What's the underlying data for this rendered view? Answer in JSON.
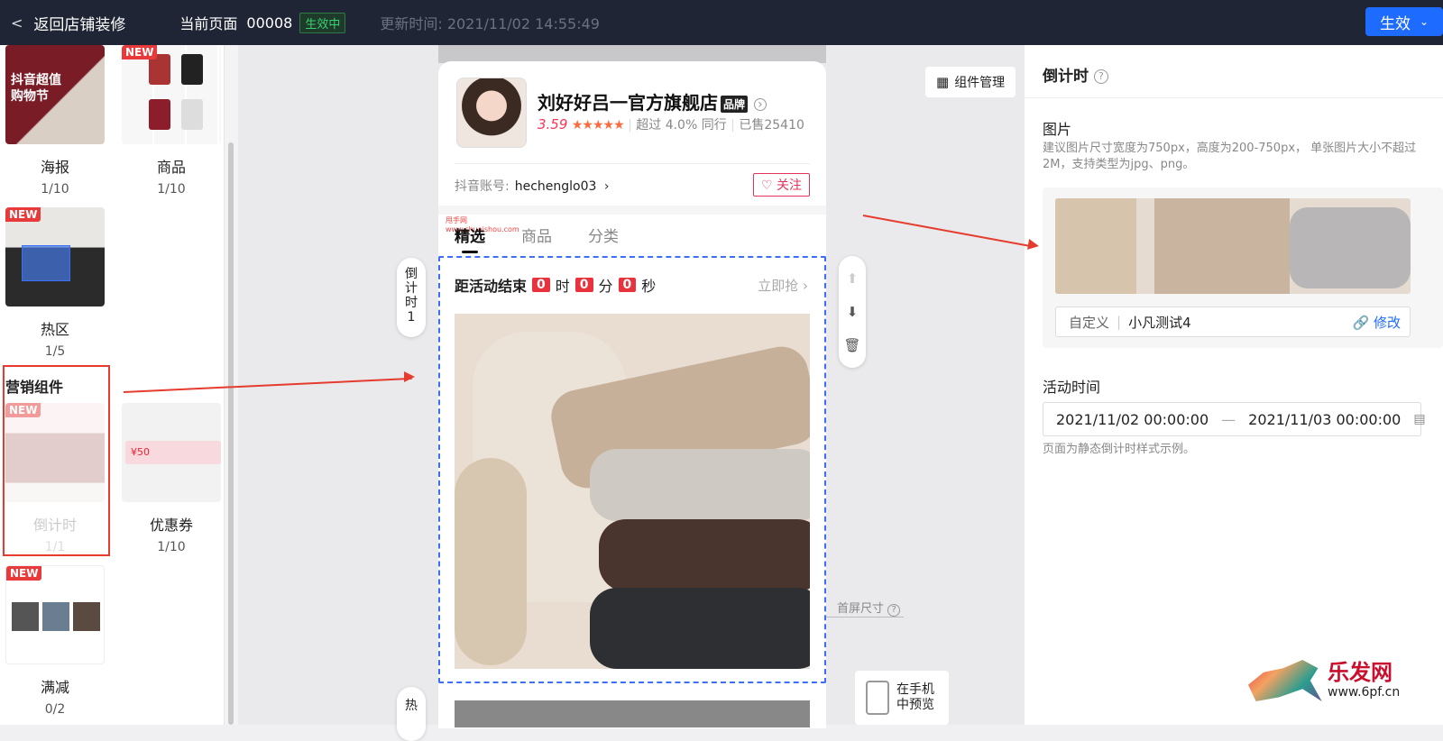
{
  "topbar": {
    "back_label": "返回店铺装修",
    "current_page_label": "当前页面",
    "page_id": "00008",
    "live_badge": "生效中",
    "updated": "更新时间: 2021/11/02 14:55:49",
    "publish_label": "生效"
  },
  "components": {
    "tiles": [
      {
        "name": "海报",
        "count": "1/10",
        "new": false
      },
      {
        "name": "商品",
        "count": "1/10",
        "new": true
      },
      {
        "name": "热区",
        "count": "1/5",
        "new": true
      },
      {
        "name": "倒计时",
        "count": "1/1",
        "new": true
      },
      {
        "name": "优惠券",
        "count": "1/10",
        "new": false
      },
      {
        "name": "满减",
        "count": "0/2",
        "new": true
      }
    ],
    "new_label": "NEW",
    "marketing_title": "营销组件",
    "poster_text": "抖音超值购物节",
    "coupon_value": "¥50"
  },
  "phone": {
    "shop_name": "刘好好吕一官方旗舰店",
    "brand_badge": "品牌",
    "rating": "3.59",
    "stars": "★★★★★",
    "peer": "超过 4.0% 同行",
    "sold": "已售25410",
    "account_label": "抖音账号:",
    "account_id": "hechenglo03",
    "follow_label": "关注",
    "watermark": "甩手网 www.shuaishou.com",
    "tabs": [
      "精选",
      "商品",
      "分类"
    ],
    "countdown": {
      "prefix": "距活动结束",
      "hours": "0",
      "h_unit": "时",
      "minutes": "0",
      "m_unit": "分",
      "seconds": "0",
      "s_unit": "秒",
      "cta": "立即抢"
    }
  },
  "canvas": {
    "side_tab": "倒计时1",
    "side_tab2": "热",
    "component_mgr": "组件管理",
    "fold_label": "首屏尺寸",
    "preview_label": "在手机中预览"
  },
  "panel": {
    "title": "倒计时",
    "image_label": "图片",
    "image_hint": "建议图片尺寸宽度为750px，高度为200-750px， 单张图片大小不超过2M，支持类型为jpg、png。",
    "link_type": "自定义",
    "link_value": "小凡测试4",
    "link_edit": "修改",
    "time_label": "活动时间",
    "start": "2021/11/02 00:00:00",
    "end": "2021/11/03 00:00:00",
    "time_hint": "页面为静态倒计时样式示例。"
  },
  "watermark": {
    "name": "乐发网",
    "url": "www.6pf.cn"
  }
}
